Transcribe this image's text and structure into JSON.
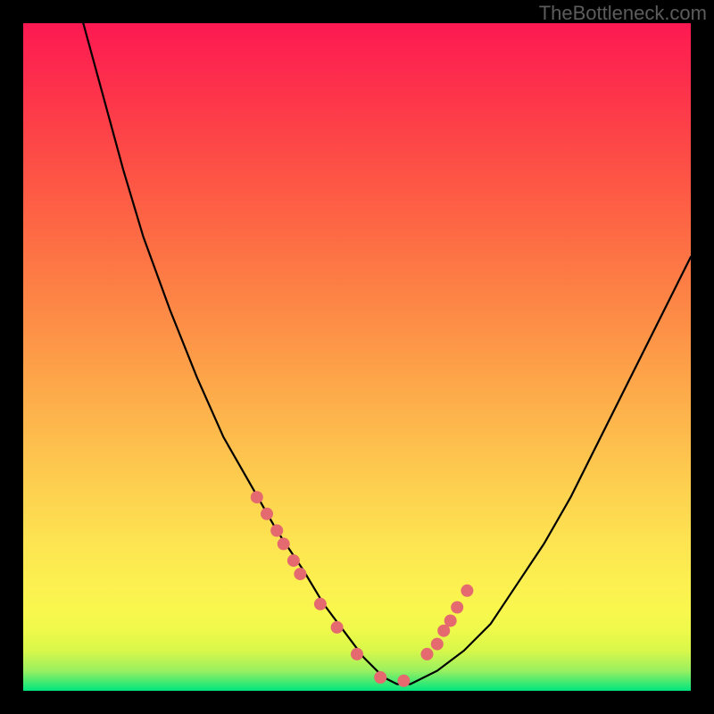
{
  "watermark": "TheBottleneck.com",
  "chart_data": {
    "type": "line",
    "title": "",
    "xlabel": "",
    "ylabel": "",
    "xlim": [
      0,
      100
    ],
    "ylim": [
      0,
      100
    ],
    "background_bands": [
      {
        "y": 0,
        "color": "#00e57e"
      },
      {
        "y": 3,
        "color": "#99f060"
      },
      {
        "y": 6,
        "color": "#d8f74a"
      },
      {
        "y": 9,
        "color": "#eef94b"
      },
      {
        "y": 12,
        "color": "#f9f74e"
      },
      {
        "y": 16,
        "color": "#fcf050"
      },
      {
        "y": 22,
        "color": "#fde451"
      },
      {
        "y": 30,
        "color": "#fdd14f"
      },
      {
        "y": 40,
        "color": "#fdb74c"
      },
      {
        "y": 50,
        "color": "#fd9c48"
      },
      {
        "y": 60,
        "color": "#fd8145"
      },
      {
        "y": 70,
        "color": "#fd6644"
      },
      {
        "y": 80,
        "color": "#fd4c46"
      },
      {
        "y": 90,
        "color": "#fd324b"
      },
      {
        "y": 100,
        "color": "#fd1952"
      }
    ],
    "series": [
      {
        "name": "bottleneck-curve",
        "x": [
          9,
          12,
          15,
          18,
          22,
          26,
          30,
          34,
          38,
          42,
          45,
          48,
          51,
          54,
          56,
          58,
          62,
          66,
          70,
          74,
          78,
          82,
          86,
          90,
          94,
          98,
          100
        ],
        "y": [
          100,
          89,
          78,
          68,
          57,
          47,
          38,
          31,
          24,
          18,
          13,
          9,
          5,
          2,
          1,
          1,
          3,
          6,
          10,
          16,
          22,
          29,
          37,
          45,
          53,
          61,
          65
        ]
      }
    ],
    "scatter": {
      "name": "sample-points",
      "x": [
        35,
        36.5,
        38,
        39,
        40.5,
        41.5,
        44.5,
        47,
        50,
        53.5,
        57,
        60.5,
        62,
        63,
        64,
        65,
        66.5
      ],
      "y": [
        29,
        26.5,
        24,
        22,
        19.5,
        17.5,
        13,
        9.5,
        5.5,
        2,
        1.5,
        5.5,
        7,
        9,
        10.5,
        12.5,
        15
      ]
    }
  }
}
